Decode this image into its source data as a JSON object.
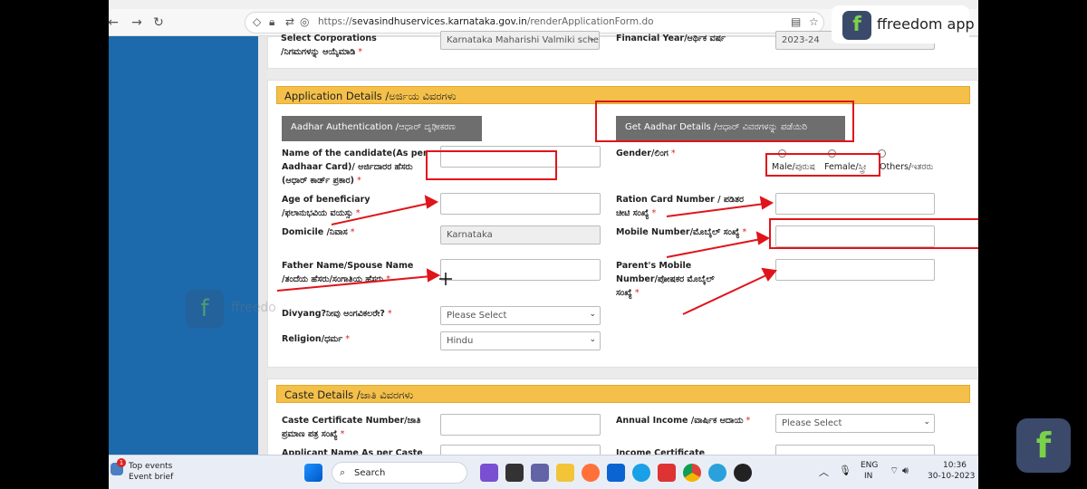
{
  "browser": {
    "url_host": "sevasindhuservices.karnataka.gov.in",
    "url_path": "/renderApplicationForm.do",
    "url_scheme": "https://"
  },
  "top_form": {
    "select_corp_label_1": "Select Corporations",
    "select_corp_label_2": "/ನಿಗಮಗಳನ್ನು ಆಯ್ಕೆಮಾಡಿ",
    "select_corp_value": "Karnataka Maharishi Valmiki sche",
    "financial_year_label": "Financial Year/ಆರ್ಥಿಕ ವರ್ಷ",
    "financial_year_value": "2023-24"
  },
  "application": {
    "section_title": "Application Details /ಅರ್ಜಿಯ ವಿವರಗಳು",
    "aadhar_auth_button": "Aadhar Authentication /ಆಧಾರ್ ದೃಢೀಕರಣ",
    "get_aadhar_button": "Get Aadhar Details /ಆಧಾರ್ ವಿವರಗಳನ್ನು ಪಡೆಯಿರಿ",
    "name_label_1": "Name of the candidate(As per",
    "name_label_2": "Aadhaar Card)/ ಅರ್ಜಿದಾರರ ಹೆಸರು",
    "name_label_3": "(ಆಧಾರ್ ಕಾರ್ಡ್ ಪ್ರಕಾರ)",
    "gender_label": "Gender/ಲಿಂಗ",
    "gender_male": "Male/ಪುರುಷ",
    "gender_female": "Female/ಸ್ತ್ರೀ",
    "gender_others": "Others/ಇತರರು",
    "age_label_1": "Age of beneficiary",
    "age_label_2": "/ಫಲಾನುಭವಿಯ ವಯಸ್ಸು",
    "ration_label_1": "Ration Card Number / ಪಡಿತರ",
    "ration_label_2": "ಚೀಟಿ ಸಂಖ್ಯೆ",
    "domicile_label": "Domicile /ನಿವಾಸ",
    "domicile_value": "Karnataka",
    "mobile_label": "Mobile Number/ಮೊಬೈಲ್ ಸಂಖ್ಯೆ",
    "father_label_1": "Father Name/Spouse Name",
    "father_label_2": "/ತಂದೆಯ ಹೆಸರು/ಸಂಗಾತಿಯ ಹೆಸರು",
    "parent_mobile_label_1": "Parent's Mobile",
    "parent_mobile_label_2": "Number/ಪೋಷಕರ ಮೊಬೈಲ್",
    "parent_mobile_label_3": "ಸಂಖ್ಯೆ",
    "divyang_label": "Divyang?ನೀವು ಅಂಗವಿಕಲರೇ?",
    "divyang_value": "Please Select",
    "religion_label": "Religion/ಧರ್ಮ",
    "religion_value": "Hindu"
  },
  "caste": {
    "section_title": "Caste Details /ಜಾತಿ ವಿವರಗಳು",
    "cert_label_1": "Caste Certificate Number/ಜಾತಿ",
    "cert_label_2": "ಪ್ರಮಾಣ ಪತ್ರ ಸಂಖ್ಯೆ",
    "annual_income_label": "Annual Income /ವಾರ್ಷಿಕ ಆದಾಯ",
    "annual_income_value": "Please Select",
    "applicant_name_label": "Applicant Name As per Caste",
    "income_cert_label": "Income Certificate"
  },
  "taskbar": {
    "weather_title": "Top events",
    "weather_sub": "Event brief",
    "notif_count": "1",
    "search_placeholder": "Search",
    "lang_1": "ENG",
    "lang_2": "IN",
    "time": "10:36",
    "date": "30-10-2023"
  },
  "brand": {
    "name": "ffreedom app",
    "logo_letter": "f",
    "watermark_text": "ffreedo"
  },
  "colors": {
    "sidebar": "#1c6aac",
    "section_header": "#f4c04a",
    "annotation_red": "#e0141b",
    "button_gray": "#6e6e6e"
  }
}
